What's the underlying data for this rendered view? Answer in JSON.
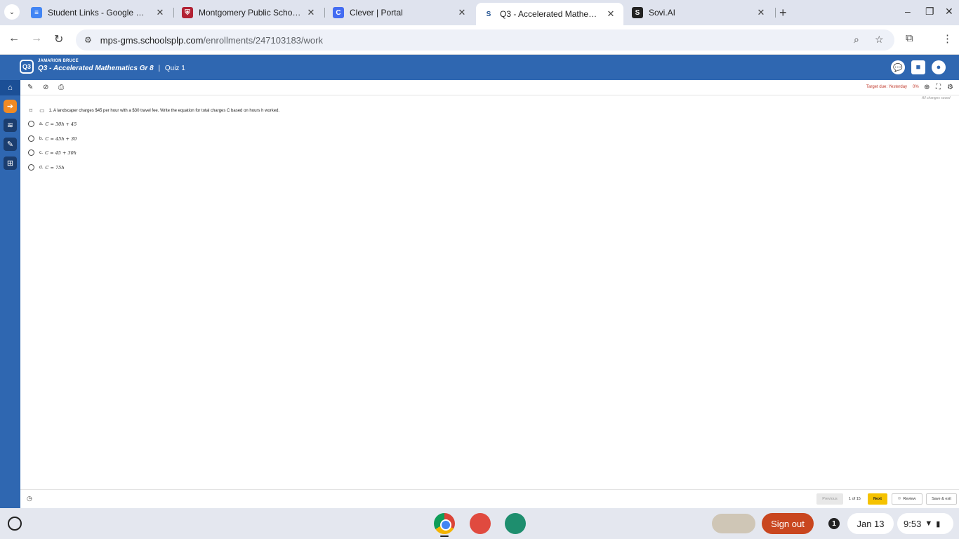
{
  "browser": {
    "tabs": [
      {
        "title": "Student Links - Google Docs",
        "favicon": "docs-icon",
        "active": false
      },
      {
        "title": "Montgomery Public Schools | ",
        "favicon": "school-crest-icon",
        "active": false
      },
      {
        "title": "Clever | Portal",
        "favicon": "clever-icon",
        "active": false
      },
      {
        "title": "Q3 - Accelerated Mathematics ",
        "favicon": "sovi-icon",
        "active": true
      },
      {
        "title": "Sovi.AI",
        "favicon": "sovi-ai-icon",
        "active": false
      }
    ],
    "url_host": "mps-gms.schoolsplp.com",
    "url_path": "/enrollments/247103183/work"
  },
  "app": {
    "student_name": "JAMARION BRUCE",
    "course_title": "Q3 - Accelerated Mathematics Gr 8",
    "separator": "|",
    "quiz_name": "Quiz 1",
    "logo_text": "Q3",
    "brand_color": "#2f67b1"
  },
  "worktools": {
    "target_due": "Target due: Yesterday",
    "progress": "0%",
    "saved_status": "All changes saved"
  },
  "question": {
    "text": "1. A landscaper charges $45 per hour with a $30 travel fee. Write the equation for total charges C based on hours h worked.",
    "choices": [
      {
        "letter": "a.",
        "equation": "C = 30h + 45"
      },
      {
        "letter": "b.",
        "equation": "C = 45h + 30"
      },
      {
        "letter": "c.",
        "equation": "C = 45 + 30h"
      },
      {
        "letter": "d.",
        "equation": "C = 75h"
      }
    ]
  },
  "footer": {
    "previous": "Previous",
    "pager": "1 of 15",
    "next": "Next",
    "review": "Review",
    "save_exit": "Save & exit"
  },
  "shelf": {
    "sign_out": "Sign out",
    "notification_count": "1",
    "date": "Jan 13",
    "time": "9:53"
  }
}
